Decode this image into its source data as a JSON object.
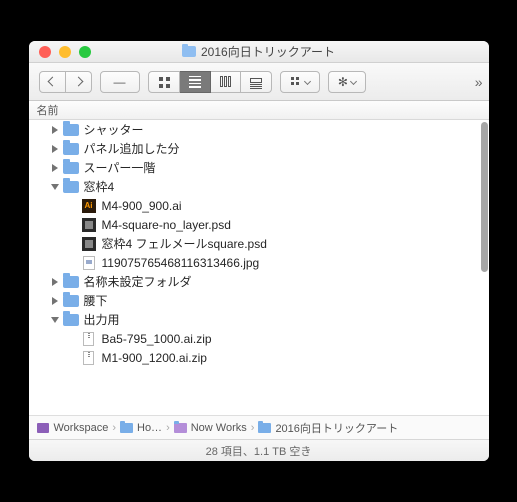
{
  "title": "2016向日トリックアート",
  "header": {
    "name_col": "名前"
  },
  "rows": [
    {
      "kind": "folder",
      "label": "シャッター",
      "depth": 1,
      "expanded": false
    },
    {
      "kind": "folder",
      "label": "パネル追加した分",
      "depth": 1,
      "expanded": false
    },
    {
      "kind": "folder",
      "label": "スーパー一階",
      "depth": 1,
      "expanded": false
    },
    {
      "kind": "folder",
      "label": "窓枠4",
      "depth": 1,
      "expanded": true
    },
    {
      "kind": "ai",
      "label": "M4-900_900.ai",
      "depth": 2
    },
    {
      "kind": "psd",
      "label": "M4-square-no_layer.psd",
      "depth": 2
    },
    {
      "kind": "psd",
      "label": "窓枠4 フェルメールsquare.psd",
      "depth": 2
    },
    {
      "kind": "jpg",
      "label": "11907576546811631​3466.jpg",
      "depth": 2
    },
    {
      "kind": "folder",
      "label": "名称未設定フォルダ",
      "depth": 1,
      "expanded": false
    },
    {
      "kind": "folder",
      "label": "腰下",
      "depth": 1,
      "expanded": false
    },
    {
      "kind": "folder",
      "label": "出力用",
      "depth": 1,
      "expanded": true
    },
    {
      "kind": "zip",
      "label": "Ba5-795_1000.ai.zip",
      "depth": 2
    },
    {
      "kind": "zip",
      "label": "M1-900_1200.ai.zip",
      "depth": 2
    }
  ],
  "path": [
    {
      "icon": "workspace",
      "label": "Workspace"
    },
    {
      "icon": "folder",
      "label": "Ho…"
    },
    {
      "icon": "folder-p",
      "label": "Now Works"
    },
    {
      "icon": "folder",
      "label": "2016向日トリックアート"
    }
  ],
  "status": "28 項目、1.1 TB 空き"
}
